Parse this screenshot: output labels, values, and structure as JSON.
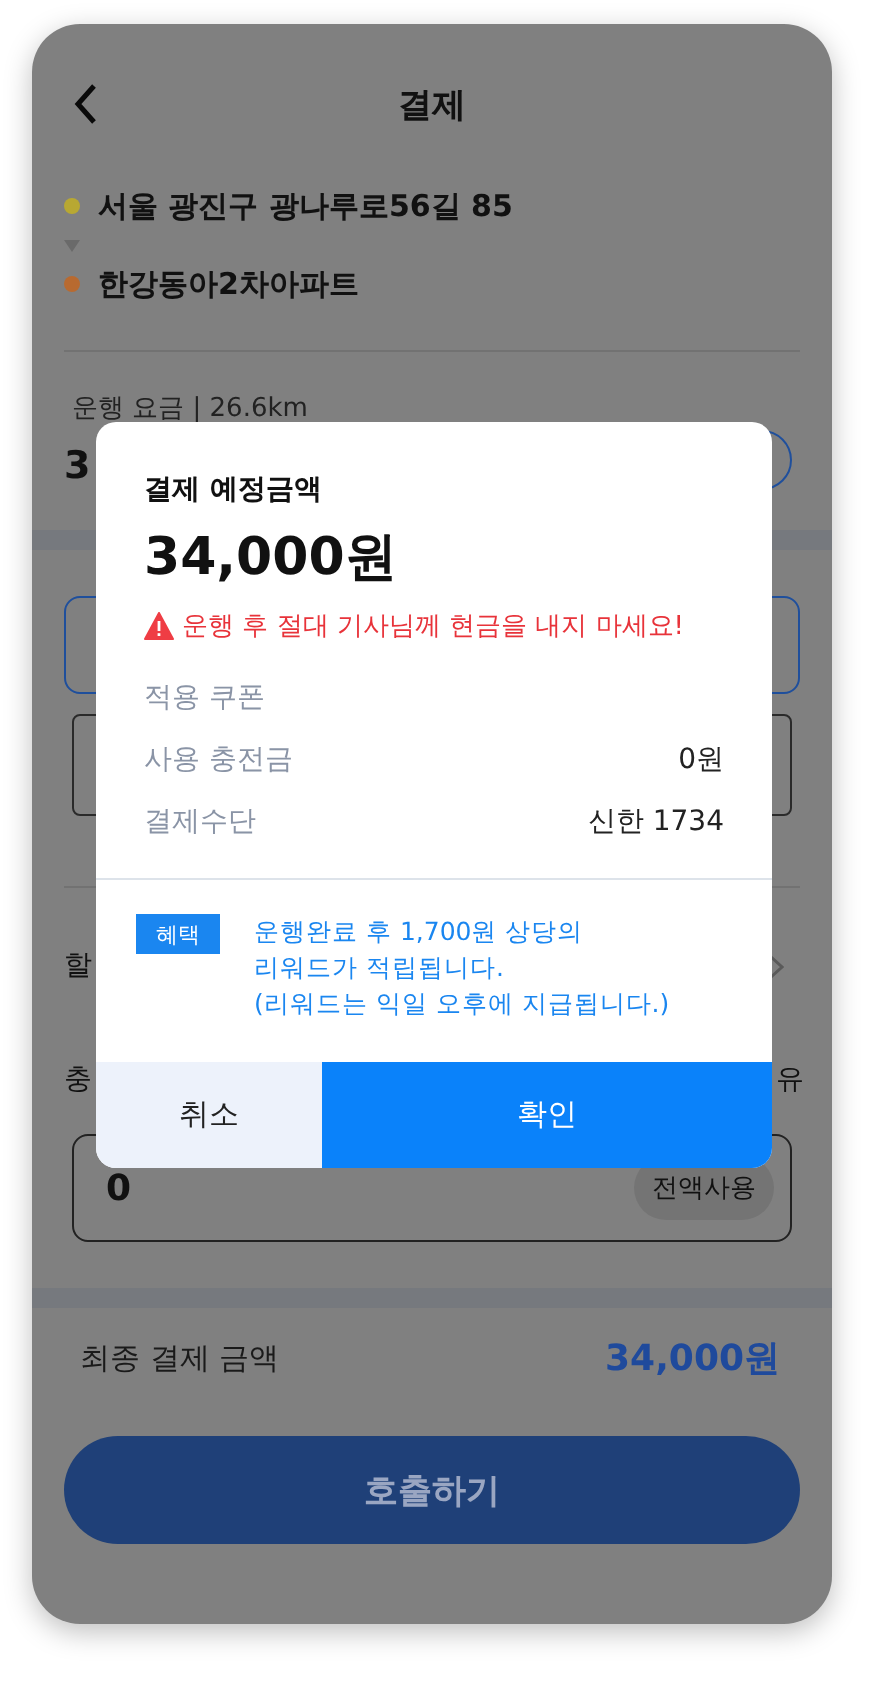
{
  "header": {
    "title": "결제"
  },
  "route": [
    {
      "address": "서울 광진구 광나루로56길 85",
      "color": "#b8a832"
    },
    {
      "address": "한강동아2차아파트",
      "color": "#b86a30"
    }
  ],
  "fare": {
    "label": "운행 요금 | 26.6km",
    "amount": "3"
  },
  "row_1": {
    "label": "할"
  },
  "row_2": {
    "label": "충",
    "note": "유"
  },
  "charge_input": {
    "value": "0",
    "button": "전액사용"
  },
  "final": {
    "label": "최종 결제 금액",
    "amount": "34,000원"
  },
  "call_button": {
    "label": "호출하기"
  },
  "modal": {
    "title": "결제 예정금액",
    "amount": "34,000원",
    "warning": "운행 후 절대 기사님께 현금을 내지 마세요!",
    "rows": [
      {
        "label": "적용 쿠폰"
      },
      {
        "label": "사용 충전금",
        "value": "0원"
      },
      {
        "label": "결제수단",
        "value": "신한 1734"
      }
    ],
    "benefit": {
      "tag": "혜택",
      "text": "운행완료 후 1,700원 상당의\n리워드가 적립됩니다.\n(리워드는 익일 오후에 지급됩니다.)"
    },
    "buttons": [
      {
        "label": "취소",
        "kind": "secondary"
      },
      {
        "label": "확인",
        "kind": "primary"
      }
    ]
  }
}
